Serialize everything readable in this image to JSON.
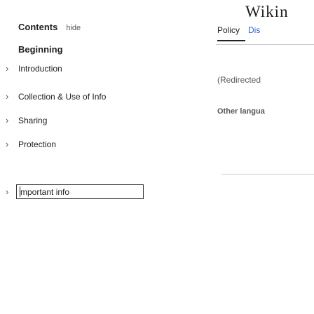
{
  "toc": {
    "title": "Contents",
    "hide_label": "hide",
    "items": [
      {
        "label": "Beginning",
        "has_chevron": false,
        "bold": true
      },
      {
        "label": "Introduction",
        "has_chevron": true,
        "bold": false
      },
      {
        "label": "Collection & Use of Info",
        "has_chevron": true,
        "bold": false
      },
      {
        "label": "Sharing",
        "has_chevron": true,
        "bold": false
      },
      {
        "label": "Protection",
        "has_chevron": true,
        "bold": false
      },
      {
        "label": "mportant info",
        "has_chevron": true,
        "bold": false
      }
    ],
    "chevron_glyph": "›"
  },
  "header": {
    "wordmark": "Wikin",
    "tabs": [
      {
        "label": "Policy",
        "active": true
      },
      {
        "label": "Dis",
        "active": false
      }
    ]
  },
  "sidebar": {
    "redirected": "(Redirected",
    "other_languages": "Other langua"
  },
  "colors": {
    "text": "#202122",
    "muted": "#54595d",
    "link": "#3366cc",
    "border": "#c8ccd1"
  }
}
